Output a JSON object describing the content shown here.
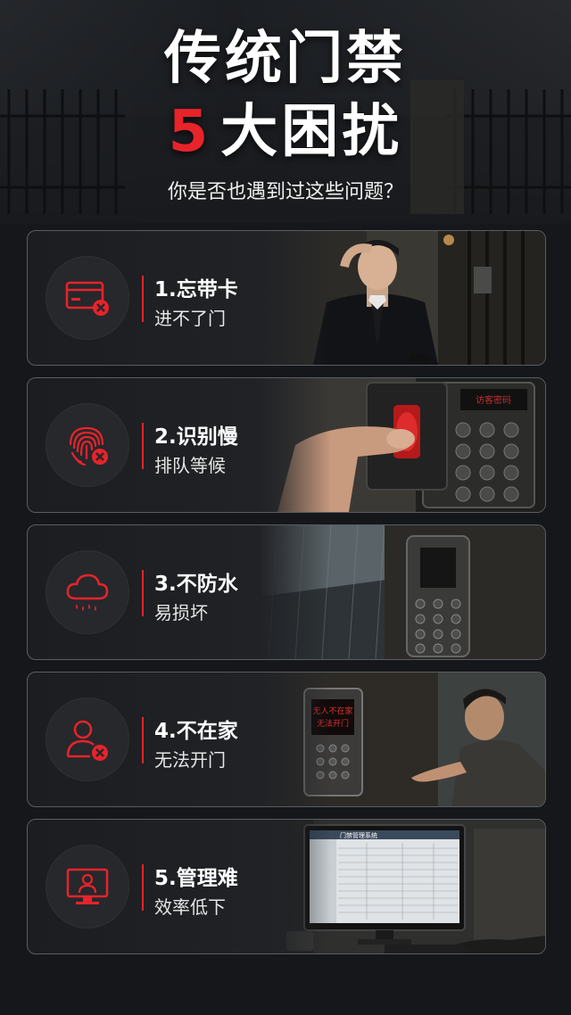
{
  "header": {
    "title_line1": "传统门禁",
    "title_number": "5",
    "title_line2": "大困扰",
    "subtitle": "你是否也遇到过这些问题？"
  },
  "colors": {
    "accent": "#e8232a",
    "background": "#15171b",
    "card_border": "#5a5d62"
  },
  "cards": [
    {
      "title": "1.忘带卡",
      "desc": "进不了门",
      "icon": "card-x-icon"
    },
    {
      "title": "2.识别慢",
      "desc": "排队等候",
      "icon": "fingerprint-x-icon"
    },
    {
      "title": "3.不防水",
      "desc": "易损坏",
      "icon": "rain-cloud-icon"
    },
    {
      "title": "4.不在家",
      "desc": "无法开门",
      "icon": "user-x-icon"
    },
    {
      "title": "5.管理难",
      "desc": "效率低下",
      "icon": "monitor-user-icon"
    }
  ],
  "photo_texts": {
    "keypad_display": "访客密码",
    "offline_display_line1": "无人不在家",
    "offline_display_line2": "无法开门",
    "monitor_title": "门禁管理系统"
  }
}
